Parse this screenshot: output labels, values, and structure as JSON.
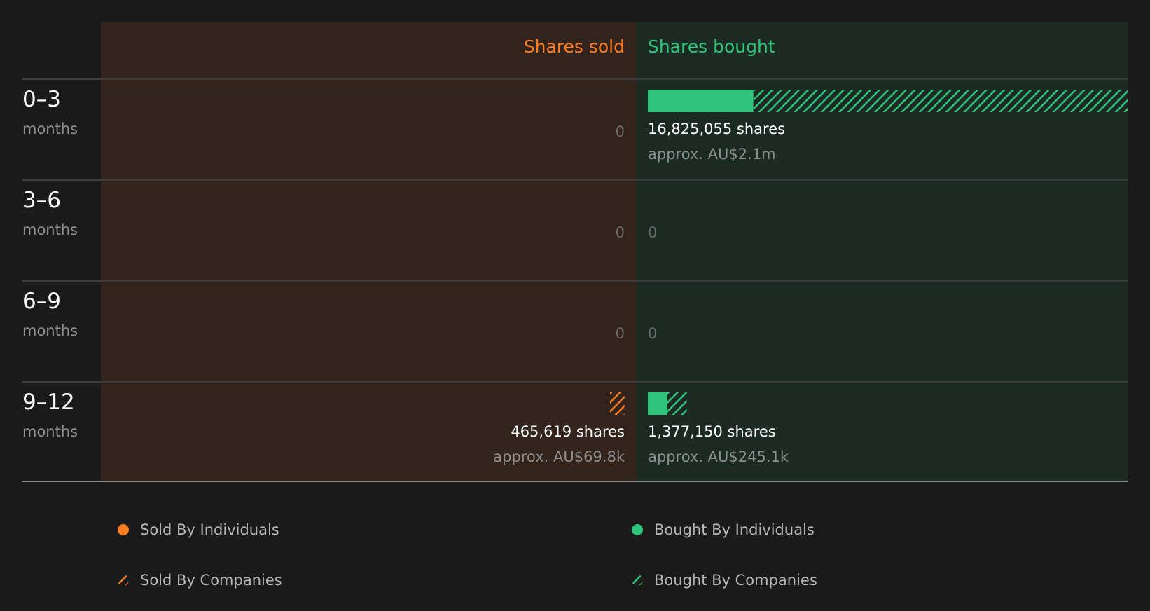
{
  "chart_data": {
    "type": "bar",
    "header": {
      "sold": "Shares sold",
      "bought": "Shares bought"
    },
    "periods": [
      {
        "label": "0–3",
        "unit": "months",
        "sold": {
          "individuals": 0,
          "companies": 0,
          "zero_label": "0"
        },
        "bought": {
          "individuals": 3700000,
          "companies": 13125055,
          "shares_label": "16,825,055 shares",
          "value_label": "approx. AU$2.1m"
        }
      },
      {
        "label": "3–6",
        "unit": "months",
        "sold": {
          "individuals": 0,
          "companies": 0,
          "zero_label": "0"
        },
        "bought": {
          "individuals": 0,
          "companies": 0,
          "zero_label": "0"
        }
      },
      {
        "label": "6–9",
        "unit": "months",
        "sold": {
          "individuals": 0,
          "companies": 0,
          "zero_label": "0"
        },
        "bought": {
          "individuals": 0,
          "companies": 0,
          "zero_label": "0"
        }
      },
      {
        "label": "9–12",
        "unit": "months",
        "sold": {
          "individuals": 0,
          "companies": 465619,
          "shares_label": "465,619 shares",
          "value_label": "approx. AU$69.8k"
        },
        "bought": {
          "individuals": 700000,
          "companies": 677150,
          "shares_label": "1,377,150 shares",
          "value_label": "approx. AU$245.1k"
        }
      }
    ],
    "max": 16825055,
    "legend": {
      "sold_individuals": "Sold By Individuals",
      "sold_companies": "Sold By Companies",
      "bought_individuals": "Bought By Individuals",
      "bought_companies": "Bought By Companies"
    },
    "colors": {
      "sold": "#ff7b1f",
      "bought": "#2ec57a",
      "sold_panel": "#32231b",
      "bought_panel": "#1b2b24",
      "background": "#1a1a1a"
    }
  }
}
